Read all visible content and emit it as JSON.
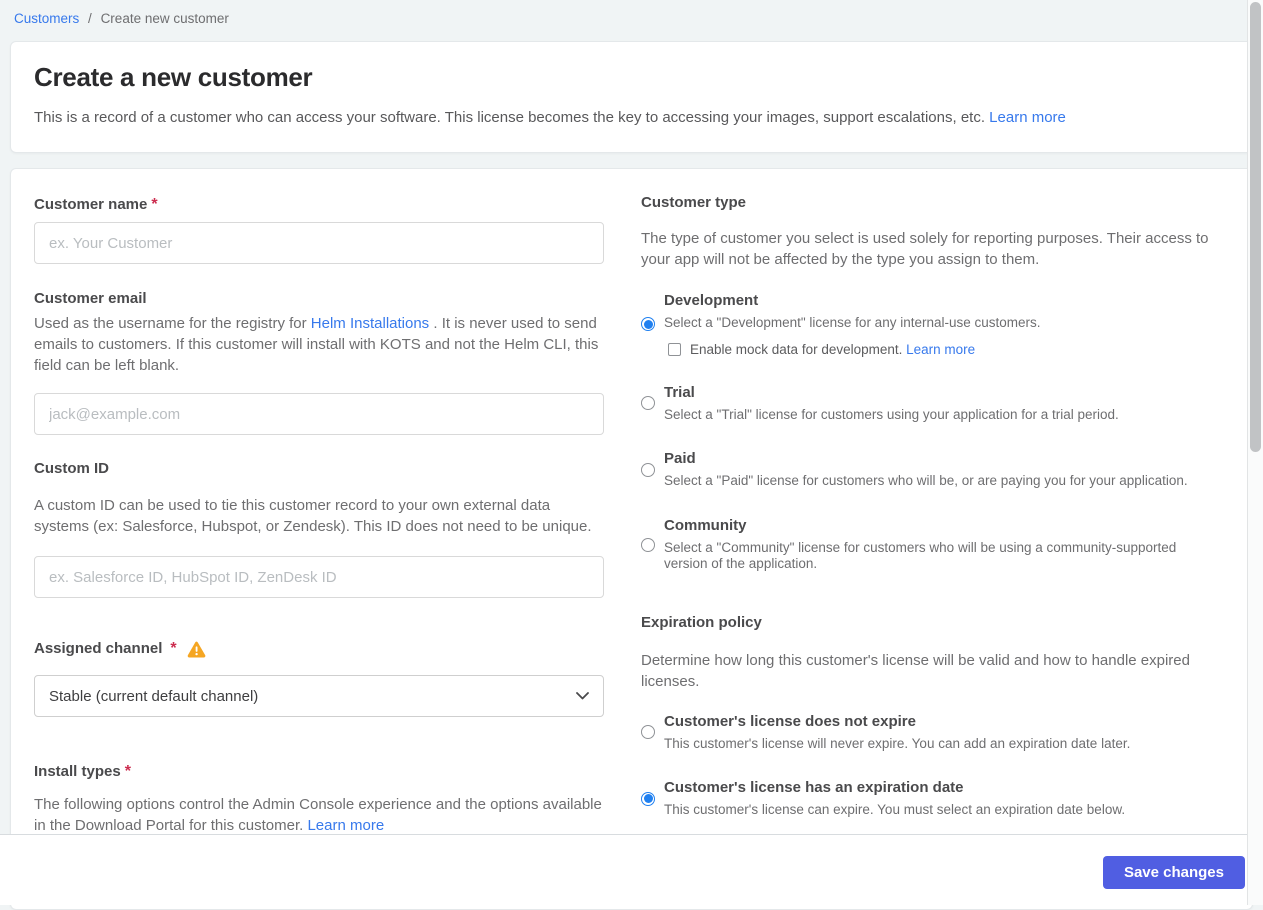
{
  "breadcrumb": {
    "customers": "Customers",
    "separator": "/",
    "current": "Create new customer"
  },
  "header": {
    "title": "Create a new customer",
    "description": "This is a record of a customer who can access your software. This license becomes the key to accessing your images, support escalations, etc. ",
    "learn_more": "Learn more"
  },
  "form": {
    "customer_name": {
      "label": "Customer name",
      "required_mark": "*",
      "placeholder": "ex. Your Customer",
      "value": ""
    },
    "customer_email": {
      "label": "Customer email",
      "description_pre": "Used as the username for the registry for ",
      "link": "Helm Installations",
      "description_post": ". It is never used to send emails to customers. If this customer will install with KOTS and not the Helm CLI, this field can be left blank.",
      "placeholder": "jack@example.com",
      "value": ""
    },
    "custom_id": {
      "label": "Custom ID",
      "description": "A custom ID can be used to tie this customer record to your own external data systems (ex: Salesforce, Hubspot, or Zendesk). This ID does not need to be unique.",
      "placeholder": "ex. Salesforce ID, HubSpot ID, ZenDesk ID",
      "value": ""
    },
    "assigned_channel": {
      "label": "Assigned channel",
      "required_mark": "*",
      "selected_value": "Stable (current default channel)"
    },
    "install_types": {
      "label": "Install types",
      "required_mark": "*",
      "description": "The following options control the Admin Console experience and the options available in the Download Portal for this customer. ",
      "learn_more": "Learn more"
    },
    "customer_type": {
      "label": "Customer type",
      "description": "The type of customer you select is used solely for reporting purposes. Their access to your app will not be affected by the type you assign to them.",
      "options": [
        {
          "title": "Development",
          "description": "Select a \"Development\" license for any internal-use customers.",
          "selected": true
        },
        {
          "title": "Trial",
          "description": "Select a \"Trial\" license for customers using your application for a trial period.",
          "selected": false
        },
        {
          "title": "Paid",
          "description": "Select a \"Paid\" license for customers who will be, or are paying you for your application.",
          "selected": false
        },
        {
          "title": "Community",
          "description": "Select a \"Community\" license for customers who will be using a community-supported version of the application.",
          "selected": false
        }
      ],
      "mock_data_checkbox": {
        "label": "Enable mock data for development. ",
        "learn_more": "Learn more",
        "checked": false
      }
    },
    "expiration_policy": {
      "label": "Expiration policy",
      "description": "Determine how long this customer's license will be valid and how to handle expired licenses.",
      "options": [
        {
          "title": "Customer's license does not expire",
          "description": "This customer's license will never expire. You can add an expiration date later.",
          "selected": false
        },
        {
          "title": "Customer's license has an expiration date",
          "description": "This customer's license can expire. You must select an expiration date below.",
          "selected": true
        }
      ]
    }
  },
  "footer": {
    "save_label": "Save changes"
  },
  "colors": {
    "link_blue": "#3779ec",
    "radio_selected_blue": "#2080f0",
    "save_button_blue": "#505ee2",
    "required_red": "#cc2d4f",
    "warning_orange": "#f5a623",
    "page_background": "#f0f4f5"
  }
}
